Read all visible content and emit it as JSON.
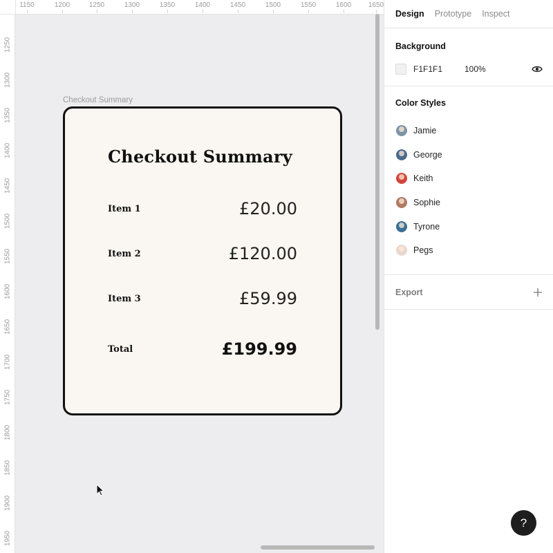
{
  "canvas": {
    "ruler_top_ticks": [
      "1150",
      "1200",
      "1250",
      "1300",
      "1350",
      "1400",
      "1450",
      "1500",
      "1550",
      "1600",
      "1650"
    ],
    "ruler_left_ticks": [
      "1250",
      "1300",
      "1350",
      "1400",
      "1450",
      "1500",
      "1550",
      "1600",
      "1650",
      "1700",
      "1750",
      "1800",
      "1850",
      "1900",
      "1950"
    ],
    "frame_label": "Checkout Summary"
  },
  "card": {
    "title": "Checkout Summary",
    "items": [
      {
        "label": "Item 1",
        "price": "£20.00"
      },
      {
        "label": "Item 2",
        "price": "£120.00"
      },
      {
        "label": "Item 3",
        "price": "£59.99"
      }
    ],
    "total_label": "Total",
    "total_price": "£199.99"
  },
  "panel": {
    "tabs": [
      "Design",
      "Prototype",
      "Inspect"
    ],
    "active_tab": "Design",
    "background": {
      "title": "Background",
      "hex": "F1F1F1",
      "opacity": "100%",
      "color": "#F1F1F1"
    },
    "color_styles": {
      "title": "Color Styles",
      "items": [
        {
          "name": "Jamie",
          "color": "#7e93a6"
        },
        {
          "name": "George",
          "color": "#4a6a8e"
        },
        {
          "name": "Keith",
          "color": "#d0453c"
        },
        {
          "name": "Sophie",
          "color": "#b07a63"
        },
        {
          "name": "Tyrone",
          "color": "#3a6f97"
        },
        {
          "name": "Pegs",
          "color": "#e9d7cf"
        }
      ]
    },
    "export": {
      "title": "Export"
    },
    "help_label": "?"
  }
}
